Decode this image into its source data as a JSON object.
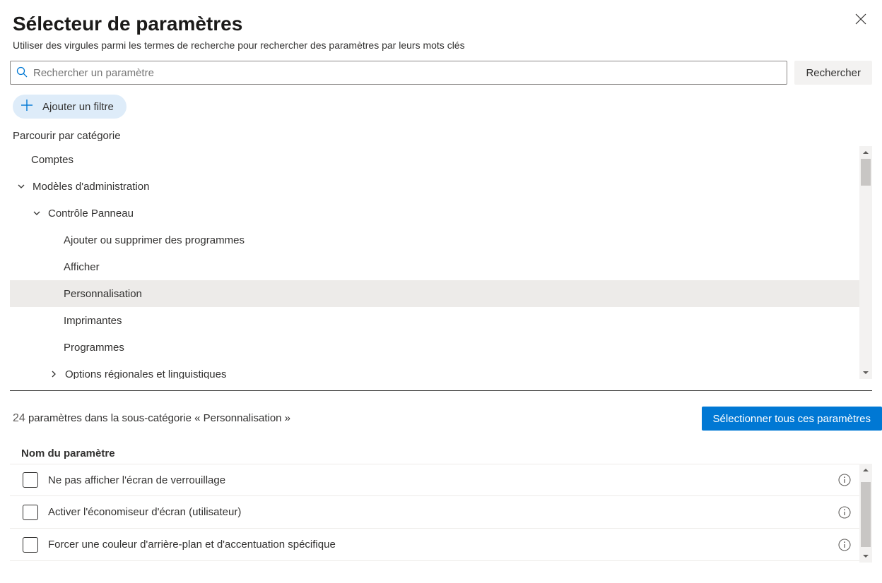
{
  "header": {
    "title": "Sélecteur de paramètres",
    "subtitle": "Utiliser des virgules  parmi les termes de recherche pour rechercher des paramètres par leurs mots clés"
  },
  "search": {
    "placeholder": "Rechercher un paramètre",
    "button": "Rechercher"
  },
  "filter": {
    "add_label": "Ajouter un filtre"
  },
  "browse": {
    "label": "Parcourir par catégorie"
  },
  "tree": [
    {
      "label": "Comptes",
      "depth": 0,
      "chevron": "none",
      "selected": false
    },
    {
      "label": "Modèles d'administration",
      "depth": 0,
      "chevron": "down",
      "selected": false
    },
    {
      "label": "Contrôle  Panneau",
      "depth": 1,
      "chevron": "down",
      "selected": false
    },
    {
      "label": "Ajouter ou supprimer des programmes",
      "depth": 2,
      "chevron": "none",
      "selected": false
    },
    {
      "label": "Afficher",
      "depth": 2,
      "chevron": "none",
      "selected": false
    },
    {
      "label": "Personnalisation",
      "depth": 2,
      "chevron": "none",
      "selected": true
    },
    {
      "label": "Imprimantes",
      "depth": 2,
      "chevron": "none",
      "selected": false
    },
    {
      "label": "Programmes",
      "depth": 2,
      "chevron": "none",
      "selected": false
    },
    {
      "label": "Options régionales et linguistiques",
      "depth": 2,
      "chevron": "right",
      "selected": false
    }
  ],
  "results": {
    "count": "24",
    "text": " paramètres dans la sous-catégorie « Personnalisation »",
    "select_all": "Sélectionner tous ces paramètres"
  },
  "columns": {
    "name": "Nom du paramètre"
  },
  "settings": [
    {
      "label": "Ne pas afficher l'écran de verrouillage"
    },
    {
      "label": "Activer l'économiseur d'écran (utilisateur)"
    },
    {
      "label": "Forcer une couleur d'arrière-plan et d'accentuation spécifique"
    }
  ],
  "colors": {
    "accent": "#0078d4"
  }
}
